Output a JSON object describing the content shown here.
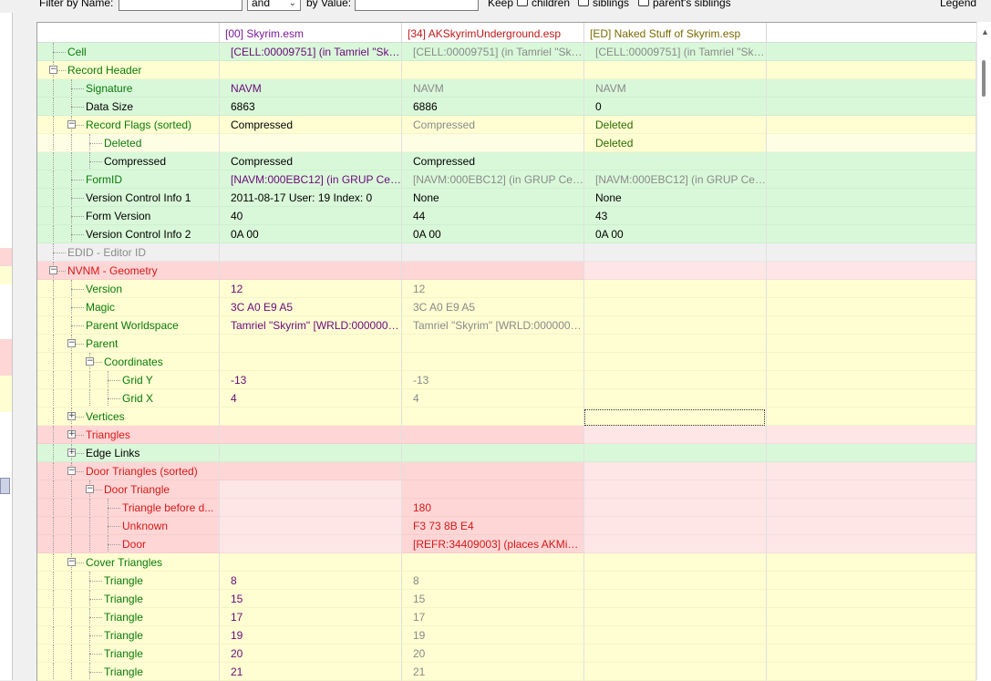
{
  "filter": {
    "name_label": "Filter by Name:",
    "and_value": "and",
    "value_label": "by Value:",
    "keep_label": "Keep",
    "children_label": "children",
    "siblings_label": "siblings",
    "parents_siblings_label": "parent's siblings",
    "legend_label": "Legend"
  },
  "columns": [
    "",
    "[00] Skyrim.esm",
    "[34] AKSkyrimUnderground.esp",
    "[ED] Naked Stuff of Skyrim.esp",
    ""
  ],
  "colors": {
    "green": "#d9f8d9",
    "yellow": "#fefed2",
    "yellow_light": "#fefee4",
    "red": "#ffd6d6",
    "red_light": "#ffe6e6",
    "gray": "#f0f0f0",
    "white": "#ffffff",
    "name_green": "#0a7a0a",
    "name_red": "#d81818",
    "val_purple": "#6a0a7a",
    "val_gray": "#8a8a8a",
    "val_green": "#2a6a00",
    "header_purple": "#7a1a9a",
    "header_red": "#c01818",
    "header_olive": "#7a6a00"
  },
  "rows": [
    {
      "name": "Cell",
      "depth": 1,
      "pm": "",
      "ncolor": "name_green",
      "bg": [
        "green",
        "green",
        "green",
        "green",
        "green"
      ],
      "v": [
        "[CELL:00009751] (in Tamriel \"Sky...",
        "[CELL:00009751] (in Tamriel \"Sky...",
        "[CELL:00009751] (in Tamriel \"Sky..."
      ],
      "vc": [
        "val_purple",
        "val_gray",
        "val_gray"
      ]
    },
    {
      "name": "Record Header",
      "depth": 1,
      "pm": "-",
      "ncolor": "name_green",
      "bg": [
        "yellow",
        "yellow",
        "yellow",
        "yellow",
        "yellow"
      ],
      "v": [
        "",
        "",
        ""
      ],
      "vc": [
        "",
        "",
        ""
      ]
    },
    {
      "name": "Signature",
      "depth": 2,
      "pm": "",
      "ncolor": "name_green",
      "bg": [
        "green",
        "green",
        "green",
        "green",
        "green"
      ],
      "v": [
        "NAVM",
        "NAVM",
        "NAVM"
      ],
      "vc": [
        "val_purple",
        "val_gray",
        "val_gray"
      ]
    },
    {
      "name": "Data Size",
      "depth": 2,
      "pm": "",
      "ncolor": "",
      "bg": [
        "green",
        "green",
        "green",
        "green",
        "green"
      ],
      "v": [
        "6863",
        "6886",
        "0"
      ],
      "vc": [
        "",
        "",
        ""
      ]
    },
    {
      "name": "Record Flags (sorted)",
      "depth": 2,
      "pm": "-",
      "ncolor": "name_green",
      "bg": [
        "yellow",
        "yellow",
        "yellow",
        "yellow",
        "yellow"
      ],
      "v": [
        "Compressed",
        "Compressed",
        "Deleted"
      ],
      "vc": [
        "",
        "val_gray",
        "val_green"
      ]
    },
    {
      "name": "Deleted",
      "depth": 3,
      "pm": "",
      "ncolor": "name_green",
      "bg": [
        "yellow_light",
        "yellow_light",
        "yellow_light",
        "yellow",
        "yellow_light"
      ],
      "v": [
        "",
        "",
        "Deleted"
      ],
      "vc": [
        "",
        "",
        "val_green"
      ]
    },
    {
      "name": "Compressed",
      "depth": 3,
      "pm": "",
      "ncolor": "",
      "bg": [
        "green",
        "green",
        "green",
        "green",
        "green"
      ],
      "v": [
        "Compressed",
        "Compressed",
        ""
      ],
      "vc": [
        "",
        "",
        ""
      ]
    },
    {
      "name": "FormID",
      "depth": 2,
      "pm": "",
      "ncolor": "name_green",
      "bg": [
        "green",
        "green",
        "green",
        "green",
        "green"
      ],
      "v": [
        "[NAVM:000EBC12] (in GRUP Cell ...",
        "[NAVM:000EBC12] (in GRUP Cell ...",
        "[NAVM:000EBC12] (in GRUP Cell ..."
      ],
      "vc": [
        "val_purple",
        "val_gray",
        "val_gray"
      ]
    },
    {
      "name": "Version Control Info 1",
      "depth": 2,
      "pm": "",
      "ncolor": "",
      "bg": [
        "green",
        "green",
        "green",
        "green",
        "green"
      ],
      "v": [
        "2011-08-17 User: 19 Index: 0",
        "None",
        "None"
      ],
      "vc": [
        "",
        "",
        ""
      ]
    },
    {
      "name": "Form Version",
      "depth": 2,
      "pm": "",
      "ncolor": "",
      "bg": [
        "green",
        "green",
        "green",
        "green",
        "green"
      ],
      "v": [
        "40",
        "44",
        "43"
      ],
      "vc": [
        "",
        "",
        ""
      ]
    },
    {
      "name": "Version Control Info 2",
      "depth": 2,
      "pm": "",
      "ncolor": "",
      "bg": [
        "green",
        "green",
        "green",
        "green",
        "green"
      ],
      "v": [
        "0A 00",
        "0A 00",
        "0A 00"
      ],
      "vc": [
        "",
        "",
        ""
      ]
    },
    {
      "name": "EDID - Editor ID",
      "depth": 1,
      "pm": "",
      "ncolor": "val_gray",
      "bg": [
        "gray",
        "gray",
        "gray",
        "gray",
        "gray"
      ],
      "v": [
        "",
        "",
        ""
      ],
      "vc": [
        "",
        "",
        ""
      ]
    },
    {
      "name": "NVNM - Geometry",
      "depth": 1,
      "pm": "-",
      "ncolor": "name_red",
      "bg": [
        "red",
        "red",
        "red",
        "red_light",
        "red_light"
      ],
      "v": [
        "",
        "",
        ""
      ],
      "vc": [
        "",
        "",
        ""
      ]
    },
    {
      "name": "Version",
      "depth": 2,
      "pm": "",
      "ncolor": "name_green",
      "bg": [
        "yellow",
        "yellow",
        "yellow",
        "yellow",
        "yellow"
      ],
      "v": [
        "12",
        "12",
        ""
      ],
      "vc": [
        "val_purple",
        "val_gray",
        ""
      ]
    },
    {
      "name": "Magic",
      "depth": 2,
      "pm": "",
      "ncolor": "name_green",
      "bg": [
        "yellow",
        "yellow",
        "yellow",
        "yellow",
        "yellow"
      ],
      "v": [
        "3C A0 E9 A5",
        "3C A0 E9 A5",
        ""
      ],
      "vc": [
        "val_purple",
        "val_gray",
        ""
      ]
    },
    {
      "name": "Parent Worldspace",
      "depth": 2,
      "pm": "",
      "ncolor": "name_green",
      "bg": [
        "yellow",
        "yellow",
        "yellow",
        "yellow",
        "yellow"
      ],
      "v": [
        "Tamriel \"Skyrim\" [WRLD:0000003...",
        "Tamriel \"Skyrim\" [WRLD:0000003...",
        ""
      ],
      "vc": [
        "val_purple",
        "val_gray",
        ""
      ]
    },
    {
      "name": "Parent",
      "depth": 2,
      "pm": "-",
      "ncolor": "name_green",
      "bg": [
        "yellow",
        "yellow",
        "yellow",
        "yellow",
        "yellow"
      ],
      "v": [
        "",
        "",
        ""
      ],
      "vc": [
        "",
        "",
        ""
      ]
    },
    {
      "name": "Coordinates",
      "depth": 3,
      "pm": "-",
      "ncolor": "name_green",
      "bg": [
        "yellow",
        "yellow",
        "yellow",
        "yellow",
        "yellow"
      ],
      "v": [
        "",
        "",
        ""
      ],
      "vc": [
        "",
        "",
        ""
      ]
    },
    {
      "name": "Grid Y",
      "depth": 4,
      "pm": "",
      "ncolor": "name_green",
      "bg": [
        "yellow",
        "yellow",
        "yellow",
        "yellow",
        "yellow"
      ],
      "v": [
        "-13",
        "-13",
        ""
      ],
      "vc": [
        "val_purple",
        "val_gray",
        ""
      ]
    },
    {
      "name": "Grid X",
      "depth": 4,
      "pm": "",
      "ncolor": "name_green",
      "bg": [
        "yellow",
        "yellow",
        "yellow",
        "yellow",
        "yellow"
      ],
      "v": [
        "4",
        "4",
        ""
      ],
      "vc": [
        "val_purple",
        "val_gray",
        ""
      ]
    },
    {
      "name": "Vertices",
      "depth": 2,
      "pm": "+",
      "ncolor": "name_green",
      "bg": [
        "yellow",
        "yellow",
        "yellow",
        "yellow",
        "yellow"
      ],
      "v": [
        "",
        "",
        ""
      ],
      "vc": [
        "",
        "",
        ""
      ]
    },
    {
      "name": "Triangles",
      "depth": 2,
      "pm": "+",
      "ncolor": "name_red",
      "bg": [
        "red",
        "red",
        "red",
        "red_light",
        "red_light"
      ],
      "v": [
        "",
        "",
        ""
      ],
      "vc": [
        "",
        "",
        ""
      ]
    },
    {
      "name": "Edge Links",
      "depth": 2,
      "pm": "+",
      "ncolor": "",
      "bg": [
        "green",
        "green",
        "green",
        "green",
        "green"
      ],
      "v": [
        "",
        "",
        ""
      ],
      "vc": [
        "",
        "",
        ""
      ]
    },
    {
      "name": "Door Triangles (sorted)",
      "depth": 2,
      "pm": "-",
      "ncolor": "name_red",
      "bg": [
        "red",
        "red",
        "red",
        "red_light",
        "red_light"
      ],
      "v": [
        "",
        "",
        ""
      ],
      "vc": [
        "",
        "",
        ""
      ]
    },
    {
      "name": "Door Triangle",
      "depth": 3,
      "pm": "-",
      "ncolor": "name_red",
      "bg": [
        "red",
        "red_light",
        "red",
        "red_light",
        "red_light"
      ],
      "v": [
        "",
        "",
        ""
      ],
      "vc": [
        "",
        "",
        ""
      ]
    },
    {
      "name": "Triangle before d...",
      "depth": 4,
      "pm": "",
      "ncolor": "name_red",
      "bg": [
        "red",
        "red_light",
        "red",
        "red_light",
        "red_light"
      ],
      "v": [
        "",
        "180",
        ""
      ],
      "vc": [
        "",
        "name_red",
        ""
      ]
    },
    {
      "name": "Unknown",
      "depth": 4,
      "pm": "",
      "ncolor": "name_red",
      "bg": [
        "red",
        "red_light",
        "red",
        "red_light",
        "red_light"
      ],
      "v": [
        "",
        "F3 73 8B E4",
        ""
      ],
      "vc": [
        "",
        "name_red",
        ""
      ]
    },
    {
      "name": "Door",
      "depth": 4,
      "pm": "",
      "ncolor": "name_red",
      "bg": [
        "red",
        "red_light",
        "red",
        "red_light",
        "red_light"
      ],
      "v": [
        "",
        "[REFR:34409003] (places AKMine...",
        ""
      ],
      "vc": [
        "",
        "name_red",
        ""
      ]
    },
    {
      "name": "Cover Triangles",
      "depth": 2,
      "pm": "-",
      "ncolor": "name_green",
      "bg": [
        "yellow",
        "yellow",
        "yellow",
        "yellow",
        "yellow"
      ],
      "v": [
        "",
        "",
        ""
      ],
      "vc": [
        "",
        "",
        ""
      ]
    },
    {
      "name": "Triangle",
      "depth": 3,
      "pm": "",
      "ncolor": "name_green",
      "bg": [
        "yellow",
        "yellow",
        "yellow",
        "yellow",
        "yellow"
      ],
      "v": [
        "8",
        "8",
        ""
      ],
      "vc": [
        "val_purple",
        "val_gray",
        ""
      ]
    },
    {
      "name": "Triangle",
      "depth": 3,
      "pm": "",
      "ncolor": "name_green",
      "bg": [
        "yellow",
        "yellow",
        "yellow",
        "yellow",
        "yellow"
      ],
      "v": [
        "15",
        "15",
        ""
      ],
      "vc": [
        "val_purple",
        "val_gray",
        ""
      ]
    },
    {
      "name": "Triangle",
      "depth": 3,
      "pm": "",
      "ncolor": "name_green",
      "bg": [
        "yellow",
        "yellow",
        "yellow",
        "yellow",
        "yellow"
      ],
      "v": [
        "17",
        "17",
        ""
      ],
      "vc": [
        "val_purple",
        "val_gray",
        ""
      ]
    },
    {
      "name": "Triangle",
      "depth": 3,
      "pm": "",
      "ncolor": "name_green",
      "bg": [
        "yellow",
        "yellow",
        "yellow",
        "yellow",
        "yellow"
      ],
      "v": [
        "19",
        "19",
        ""
      ],
      "vc": [
        "val_purple",
        "val_gray",
        ""
      ]
    },
    {
      "name": "Triangle",
      "depth": 3,
      "pm": "",
      "ncolor": "name_green",
      "bg": [
        "yellow",
        "yellow",
        "yellow",
        "yellow",
        "yellow"
      ],
      "v": [
        "20",
        "20",
        ""
      ],
      "vc": [
        "val_purple",
        "val_gray",
        ""
      ]
    },
    {
      "name": "Triangle",
      "depth": 3,
      "pm": "",
      "ncolor": "name_green",
      "bg": [
        "yellow",
        "yellow",
        "yellow",
        "yellow",
        "yellow"
      ],
      "v": [
        "21",
        "21",
        ""
      ],
      "vc": [
        "val_purple",
        "val_gray",
        ""
      ]
    }
  ],
  "left_strip": [
    "white",
    "white",
    "white",
    "white",
    "white",
    "white",
    "white",
    "white",
    "white",
    "white",
    "white",
    "white",
    "red",
    "yellow",
    "white",
    "white",
    "white",
    "red",
    "red",
    "yellow",
    "yellow",
    "white",
    "white",
    "white",
    "white",
    "white",
    "white",
    "white",
    "white",
    "white",
    "white",
    "white",
    "white",
    "white",
    "white"
  ]
}
